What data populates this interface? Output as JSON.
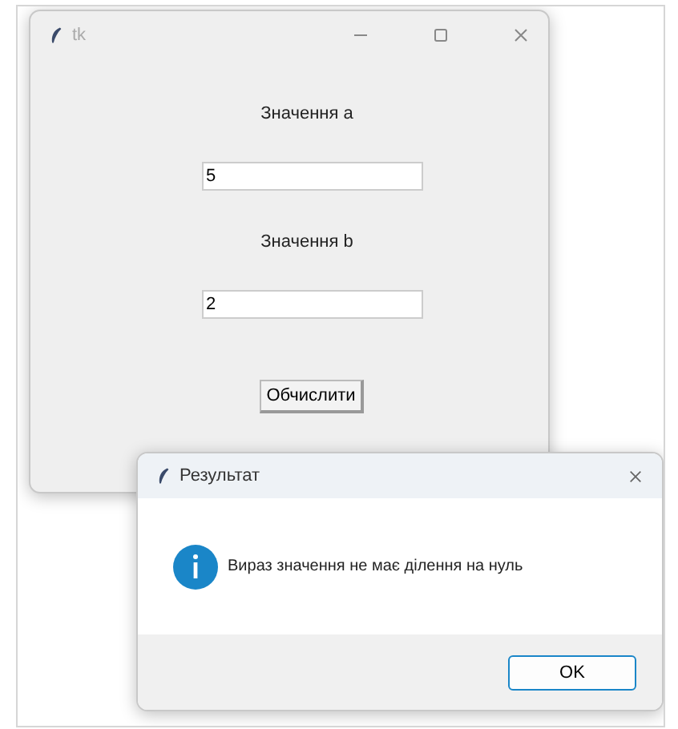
{
  "main_window": {
    "title": "tk",
    "label_a": "Значення a",
    "input_a": "5",
    "label_b": "Значення b",
    "input_b": "2",
    "button": "Обчислити"
  },
  "dialog": {
    "title": "Результат",
    "message": "Вираз значення не має ділення на нуль",
    "button": "OK"
  }
}
